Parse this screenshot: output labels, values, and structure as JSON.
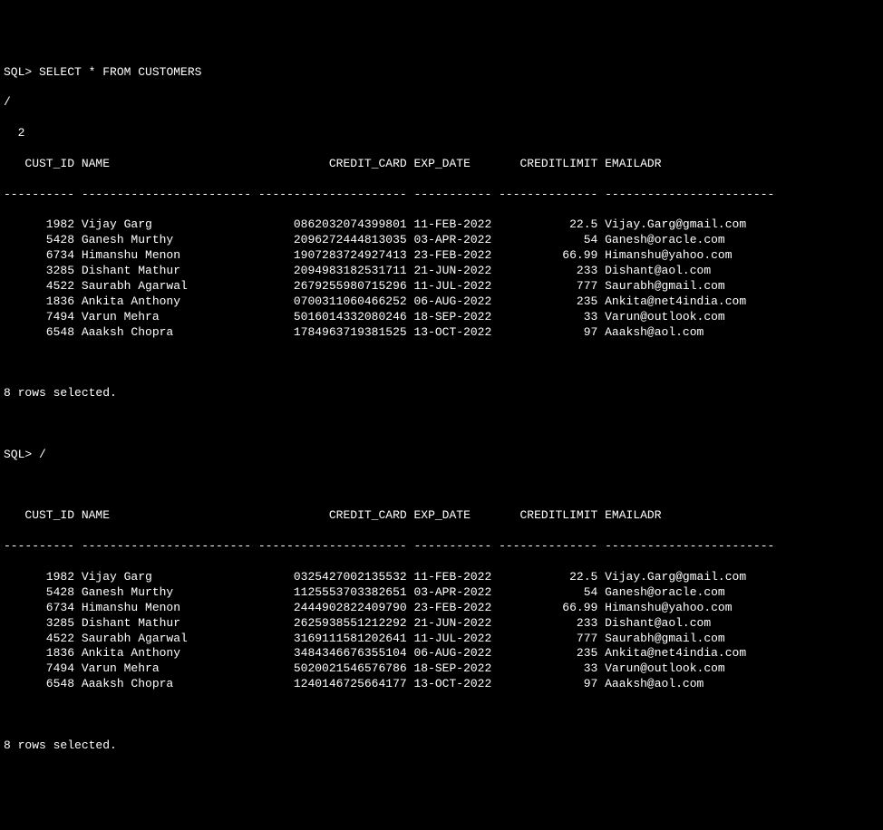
{
  "prompt1": "SQL> ",
  "query": "SELECT * FROM CUSTOMERS",
  "continuation": "/",
  "page_number": "  2",
  "prompt2": "SQL> /",
  "columns": {
    "cust_id": "CUST_ID",
    "name": "NAME",
    "credit_card": "CREDIT_CARD",
    "exp_date": "EXP_DATE",
    "creditlimit": "CREDITLIMIT",
    "emailadr": "EMAILADR"
  },
  "separator_cust_id": "----------",
  "separator_name": "------------------------",
  "separator_credit_card": "---------------------",
  "separator_exp_date": "-----------",
  "separator_creditlimit": "--------------",
  "separator_emailadr": "------------------------",
  "result1_rows": [
    {
      "cust_id": "1982",
      "name": "Vijay Garg",
      "credit_card": "0862032074399801",
      "exp_date": "11-FEB-2022",
      "creditlimit": "22.5",
      "emailadr": "Vijay.Garg@gmail.com"
    },
    {
      "cust_id": "5428",
      "name": "Ganesh Murthy",
      "credit_card": "2096272444813035",
      "exp_date": "03-APR-2022",
      "creditlimit": "54",
      "emailadr": "Ganesh@oracle.com"
    },
    {
      "cust_id": "6734",
      "name": "Himanshu Menon",
      "credit_card": "1907283724927413",
      "exp_date": "23-FEB-2022",
      "creditlimit": "66.99",
      "emailadr": "Himanshu@yahoo.com"
    },
    {
      "cust_id": "3285",
      "name": "Dishant Mathur",
      "credit_card": "2094983182531711",
      "exp_date": "21-JUN-2022",
      "creditlimit": "233",
      "emailadr": "Dishant@aol.com"
    },
    {
      "cust_id": "4522",
      "name": "Saurabh Agarwal",
      "credit_card": "2679255980715296",
      "exp_date": "11-JUL-2022",
      "creditlimit": "777",
      "emailadr": "Saurabh@gmail.com"
    },
    {
      "cust_id": "1836",
      "name": "Ankita Anthony",
      "credit_card": "0700311060466252",
      "exp_date": "06-AUG-2022",
      "creditlimit": "235",
      "emailadr": "Ankita@net4india.com"
    },
    {
      "cust_id": "7494",
      "name": "Varun Mehra",
      "credit_card": "5016014332080246",
      "exp_date": "18-SEP-2022",
      "creditlimit": "33",
      "emailadr": "Varun@outlook.com"
    },
    {
      "cust_id": "6548",
      "name": "Aaaksh Chopra",
      "credit_card": "1784963719381525",
      "exp_date": "13-OCT-2022",
      "creditlimit": "97",
      "emailadr": "Aaaksh@aol.com"
    }
  ],
  "result2_rows": [
    {
      "cust_id": "1982",
      "name": "Vijay Garg",
      "credit_card": "0325427002135532",
      "exp_date": "11-FEB-2022",
      "creditlimit": "22.5",
      "emailadr": "Vijay.Garg@gmail.com"
    },
    {
      "cust_id": "5428",
      "name": "Ganesh Murthy",
      "credit_card": "1125553703382651",
      "exp_date": "03-APR-2022",
      "creditlimit": "54",
      "emailadr": "Ganesh@oracle.com"
    },
    {
      "cust_id": "6734",
      "name": "Himanshu Menon",
      "credit_card": "2444902822409790",
      "exp_date": "23-FEB-2022",
      "creditlimit": "66.99",
      "emailadr": "Himanshu@yahoo.com"
    },
    {
      "cust_id": "3285",
      "name": "Dishant Mathur",
      "credit_card": "2625938551212292",
      "exp_date": "21-JUN-2022",
      "creditlimit": "233",
      "emailadr": "Dishant@aol.com"
    },
    {
      "cust_id": "4522",
      "name": "Saurabh Agarwal",
      "credit_card": "3169111581202641",
      "exp_date": "11-JUL-2022",
      "creditlimit": "777",
      "emailadr": "Saurabh@gmail.com"
    },
    {
      "cust_id": "1836",
      "name": "Ankita Anthony",
      "credit_card": "3484346676355104",
      "exp_date": "06-AUG-2022",
      "creditlimit": "235",
      "emailadr": "Ankita@net4india.com"
    },
    {
      "cust_id": "7494",
      "name": "Varun Mehra",
      "credit_card": "5020021546576786",
      "exp_date": "18-SEP-2022",
      "creditlimit": "33",
      "emailadr": "Varun@outlook.com"
    },
    {
      "cust_id": "6548",
      "name": "Aaaksh Chopra",
      "credit_card": "1240146725664177",
      "exp_date": "13-OCT-2022",
      "creditlimit": "97",
      "emailadr": "Aaaksh@aol.com"
    }
  ],
  "rows_selected": "8 rows selected."
}
